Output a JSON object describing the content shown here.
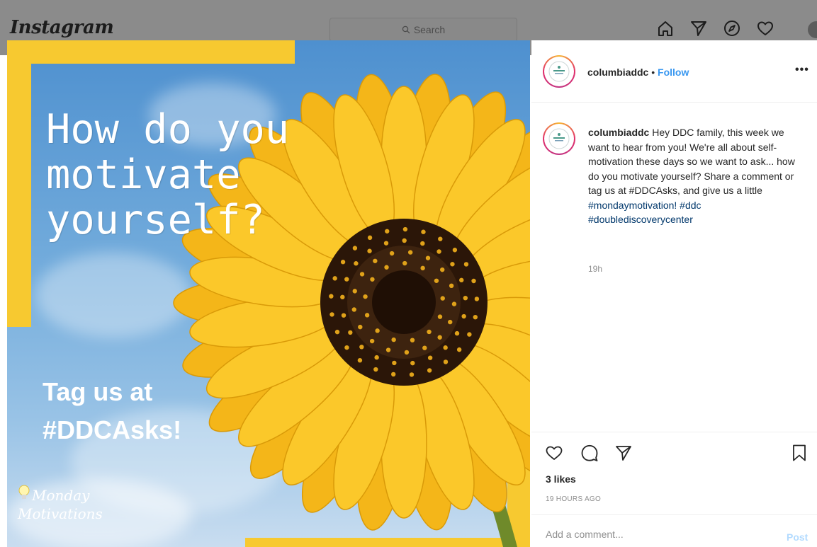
{
  "nav": {
    "logo": "Instagram",
    "search_placeholder": "Search",
    "icons": [
      "home-icon",
      "direct-icon",
      "explore-icon",
      "activity-icon",
      "profile-avatar"
    ]
  },
  "post_image": {
    "headline_lines": [
      "How do you",
      "motivate",
      "yourself?"
    ],
    "tagline_lines": [
      "Tag us at",
      "#DDCAsks!"
    ],
    "badge_lines": [
      "Monday",
      "Motivations"
    ],
    "accent_color": "#f7c930"
  },
  "panel": {
    "header": {
      "username": "columbiaddc",
      "separator": "•",
      "follow_label": "Follow",
      "more_label": "•••"
    },
    "caption": {
      "username": "columbiaddc",
      "text": "Hey DDC family, this week we want to hear from you! We're all about self-motivation these days so we want to ask... how do you motivate yourself? Share a comment or tag us at #DDCAsks, and give us a little",
      "hashtags": "#mondaymotivation! #ddc #doublediscoverycenter",
      "time": "19h"
    },
    "actions": [
      "like-icon",
      "comment-icon",
      "share-icon",
      "save-icon"
    ],
    "likes": "3 likes",
    "posted": "19 HOURS AGO",
    "comment_placeholder": "Add a comment...",
    "post_label": "Post"
  }
}
